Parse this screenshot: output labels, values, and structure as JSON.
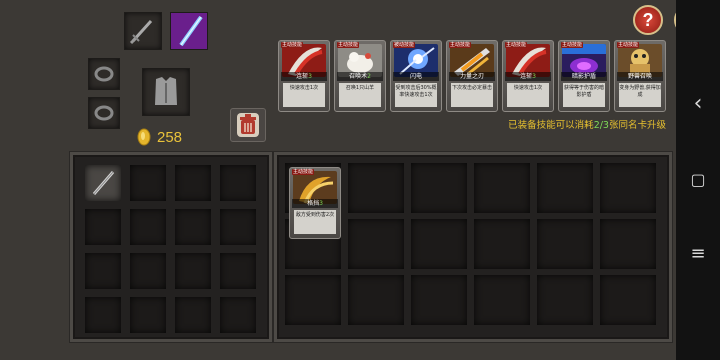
{
  "currency": {
    "amount": "258",
    "icon": "gold-coin-icon",
    "color": "#e9c23a"
  },
  "buttons": {
    "help_label": "?",
    "close_label": "✕",
    "trash_icon": "trash-icon"
  },
  "hint": {
    "prefix": "已装备技能可以消耗",
    "count": "2/3",
    "suffix": "张同名卡升级",
    "color": "#e6c02f",
    "count_color": "#7fd957"
  },
  "equipment_slots": [
    {
      "name": "weapon-slot",
      "icon": "sword-icon"
    },
    {
      "name": "weapon-skin-slot",
      "icon": "blue-blade-icon"
    },
    {
      "name": "accessory-slot-1",
      "icon": "ring-icon"
    },
    {
      "name": "armor-slot",
      "icon": "armor-icon"
    },
    {
      "name": "accessory-slot-2",
      "icon": "ring-icon"
    }
  ],
  "equipped_cards": [
    {
      "tag": "主动技能",
      "name": "连斩",
      "level": "3",
      "desc": "快速攻击1次",
      "art": "red"
    },
    {
      "tag": "主动技能",
      "name": "召唤术",
      "level": "2",
      "desc": "召唤1只山羊",
      "art": "white"
    },
    {
      "tag": "被动技能",
      "name": "闪电",
      "level": "",
      "desc": "受到攻击后30%概率快速攻击1次",
      "art": "blue"
    },
    {
      "tag": "主动技能",
      "name": "力量之刃",
      "level": "",
      "desc": "下次攻击必定暴击",
      "art": "orange"
    },
    {
      "tag": "主动技能",
      "name": "连斩",
      "level": "3",
      "desc": "快速攻击1次",
      "art": "red"
    },
    {
      "tag": "主动技能",
      "name": "暗影护盾",
      "level": "",
      "desc": "获得等于伤害的暗影护盾",
      "art": "purple"
    },
    {
      "tag": "主动技能",
      "name": "野兽召唤",
      "level": "",
      "desc": "变身为野兽,获得加成",
      "art": "beast"
    }
  ],
  "inventory_card": {
    "tag": "主动技能",
    "name": "格挡",
    "level": "3",
    "desc": "敌方受到伤害2次",
    "art": "gold"
  },
  "left_inventory": {
    "first_item_icon": "dagger-icon"
  },
  "navbar": {
    "back_icon": "‹",
    "home_icon": "▢",
    "menu_icon": "≡"
  }
}
